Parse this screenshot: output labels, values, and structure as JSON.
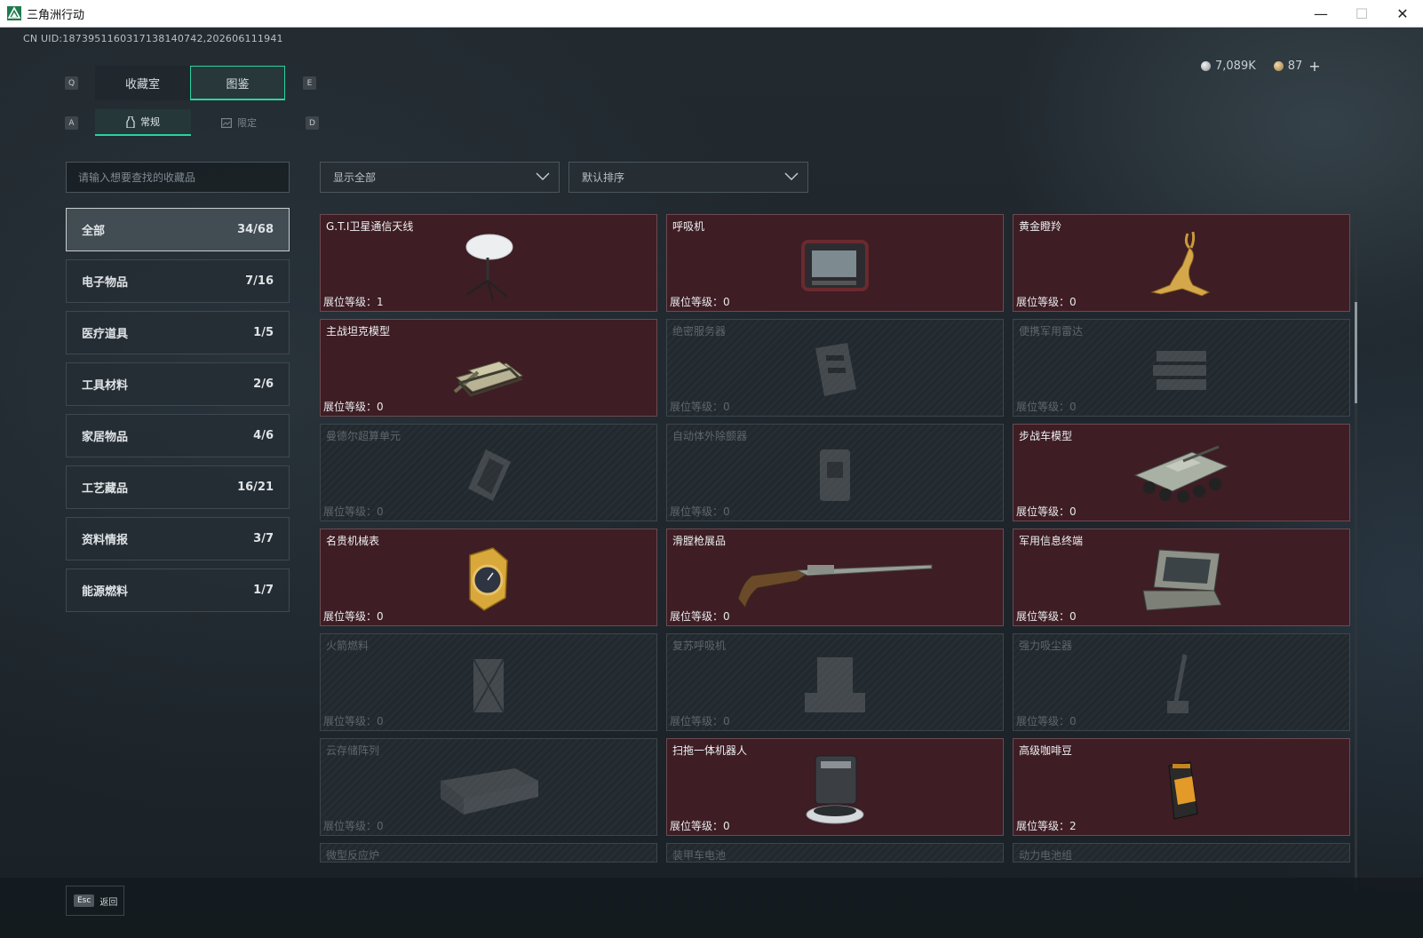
{
  "window": {
    "title": "三角洲行动",
    "minimize": "—",
    "maximize": "☐",
    "close": "✕"
  },
  "uid": "CN UID:1873951160317138140742,202606111941",
  "currency": {
    "silver": "7,089K",
    "gold": "87",
    "plus": "+"
  },
  "keys": {
    "q": "Q",
    "e": "E",
    "a": "A",
    "d": "D"
  },
  "tabs": [
    {
      "label": "收藏室"
    },
    {
      "label": "图鉴"
    }
  ],
  "subtabs": [
    {
      "label": "常规"
    },
    {
      "label": "限定"
    }
  ],
  "search": {
    "placeholder": "请输入想要查找的收藏品"
  },
  "filters": {
    "show": "显示全部",
    "sort": "默认排序"
  },
  "categories": [
    {
      "label": "全部",
      "count": "34/68"
    },
    {
      "label": "电子物品",
      "count": "7/16"
    },
    {
      "label": "医疗道具",
      "count": "1/5"
    },
    {
      "label": "工具材料",
      "count": "2/6"
    },
    {
      "label": "家居物品",
      "count": "4/6"
    },
    {
      "label": "工艺藏品",
      "count": "16/21"
    },
    {
      "label": "资料情报",
      "count": "3/7"
    },
    {
      "label": "能源燃料",
      "count": "1/7"
    }
  ],
  "level_label": "展位等级：",
  "items": [
    {
      "name": "G.T.I卫星通信天线",
      "level": "1",
      "owned": true,
      "icon": "satellite-dish-icon"
    },
    {
      "name": "呼吸机",
      "level": "0",
      "owned": true,
      "icon": "ventilator-icon"
    },
    {
      "name": "黄金瞪羚",
      "level": "0",
      "owned": true,
      "icon": "golden-gazelle-icon"
    },
    {
      "name": "主战坦克模型",
      "level": "0",
      "owned": true,
      "icon": "tank-icon"
    },
    {
      "name": "绝密服务器",
      "level": "0",
      "owned": false,
      "icon": "server-icon"
    },
    {
      "name": "便携军用雷达",
      "level": "0",
      "owned": false,
      "icon": "radar-icon"
    },
    {
      "name": "曼德尔超算单元",
      "level": "0",
      "owned": false,
      "icon": "computing-unit-icon"
    },
    {
      "name": "自动体外除颤器",
      "level": "0",
      "owned": false,
      "icon": "defibrillator-icon"
    },
    {
      "name": "步战车模型",
      "level": "0",
      "owned": true,
      "icon": "ifv-icon"
    },
    {
      "name": "名贵机械表",
      "level": "0",
      "owned": true,
      "icon": "watch-icon"
    },
    {
      "name": "滑膛枪展品",
      "level": "0",
      "owned": true,
      "icon": "musket-icon"
    },
    {
      "name": "军用信息终端",
      "level": "0",
      "owned": true,
      "icon": "terminal-icon"
    },
    {
      "name": "火箭燃料",
      "level": "0",
      "owned": false,
      "icon": "rocket-fuel-icon"
    },
    {
      "name": "复苏呼吸机",
      "level": "0",
      "owned": false,
      "icon": "resuscitator-icon"
    },
    {
      "name": "强力吸尘器",
      "level": "0",
      "owned": false,
      "icon": "vacuum-icon"
    },
    {
      "name": "云存储阵列",
      "level": "0",
      "owned": false,
      "icon": "storage-array-icon"
    },
    {
      "name": "扫拖一体机器人",
      "level": "0",
      "owned": true,
      "icon": "robot-vacuum-icon"
    },
    {
      "name": "高级咖啡豆",
      "level": "2",
      "owned": true,
      "icon": "coffee-bag-icon"
    },
    {
      "name": "微型反应炉",
      "level": "",
      "owned": false,
      "icon": "reactor-icon"
    },
    {
      "name": "装甲车电池",
      "level": "",
      "owned": false,
      "icon": "battery-icon"
    },
    {
      "name": "动力电池组",
      "level": "",
      "owned": false,
      "icon": "battery-pack-icon"
    }
  ],
  "bottom": {
    "esc_key": "Esc",
    "esc_label": "返回"
  }
}
